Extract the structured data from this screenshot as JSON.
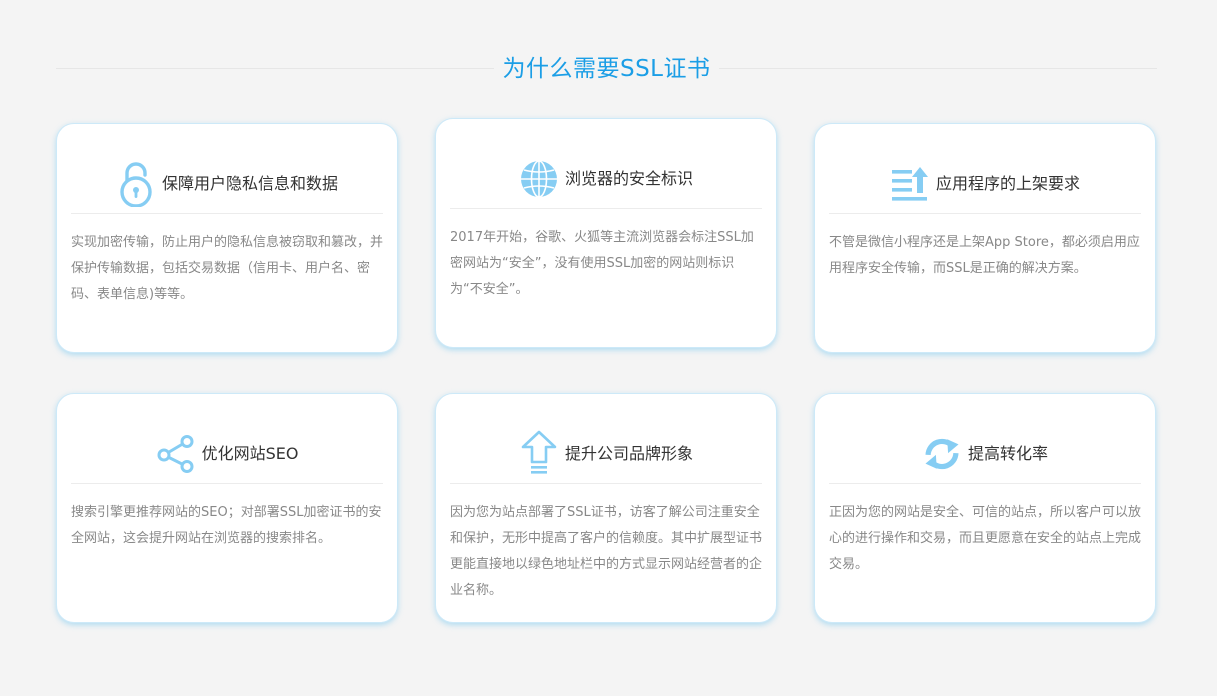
{
  "section": {
    "title": "为什么需要SSL证书"
  },
  "cards": [
    {
      "icon": "lock-icon",
      "title": "保障用户隐私信息和数据",
      "desc": "实现加密传输，防止用户的隐私信息被窃取和篡改，并保护传输数据，包括交易数据（信用卡、用户名、密码、表单信息)等等。"
    },
    {
      "icon": "globe-icon",
      "title": "浏览器的安全标识",
      "desc": "2017年开始，谷歌、火狐等主流浏览器会标注SSL加密网站为“安全”，没有使用SSL加密的网站则标识为“不安全”。"
    },
    {
      "icon": "upload-list-icon",
      "title": "应用程序的上架要求",
      "desc": "不管是微信小程序还是上架App Store，都必须启用应用程序安全传输，而SSL是正确的解决方案。"
    },
    {
      "icon": "share-icon",
      "title": "优化网站SEO",
      "desc": "搜索引擎更推荐网站的SEO；对部署SSL加密证书的安全网站，这会提升网站在浏览器的搜索排名。"
    },
    {
      "icon": "arrow-up-icon",
      "title": "提升公司品牌形象",
      "desc": "因为您为站点部署了SSL证书，访客了解公司注重安全和保护，无形中提高了客户的信赖度。其中扩展型证书更能直接地以绿色地址栏中的方式显示网站经营者的企业名称。"
    },
    {
      "icon": "refresh-icon",
      "title": "提高转化率",
      "desc": "正因为您的网站是安全、可信的站点，所以客户可以放心的进行操作和交易，而且更愿意在安全的站点上完成交易。"
    }
  ],
  "colors": {
    "accent": "#1b9ee6",
    "icon": "#86cdf3",
    "background": "#f4f4f4"
  }
}
